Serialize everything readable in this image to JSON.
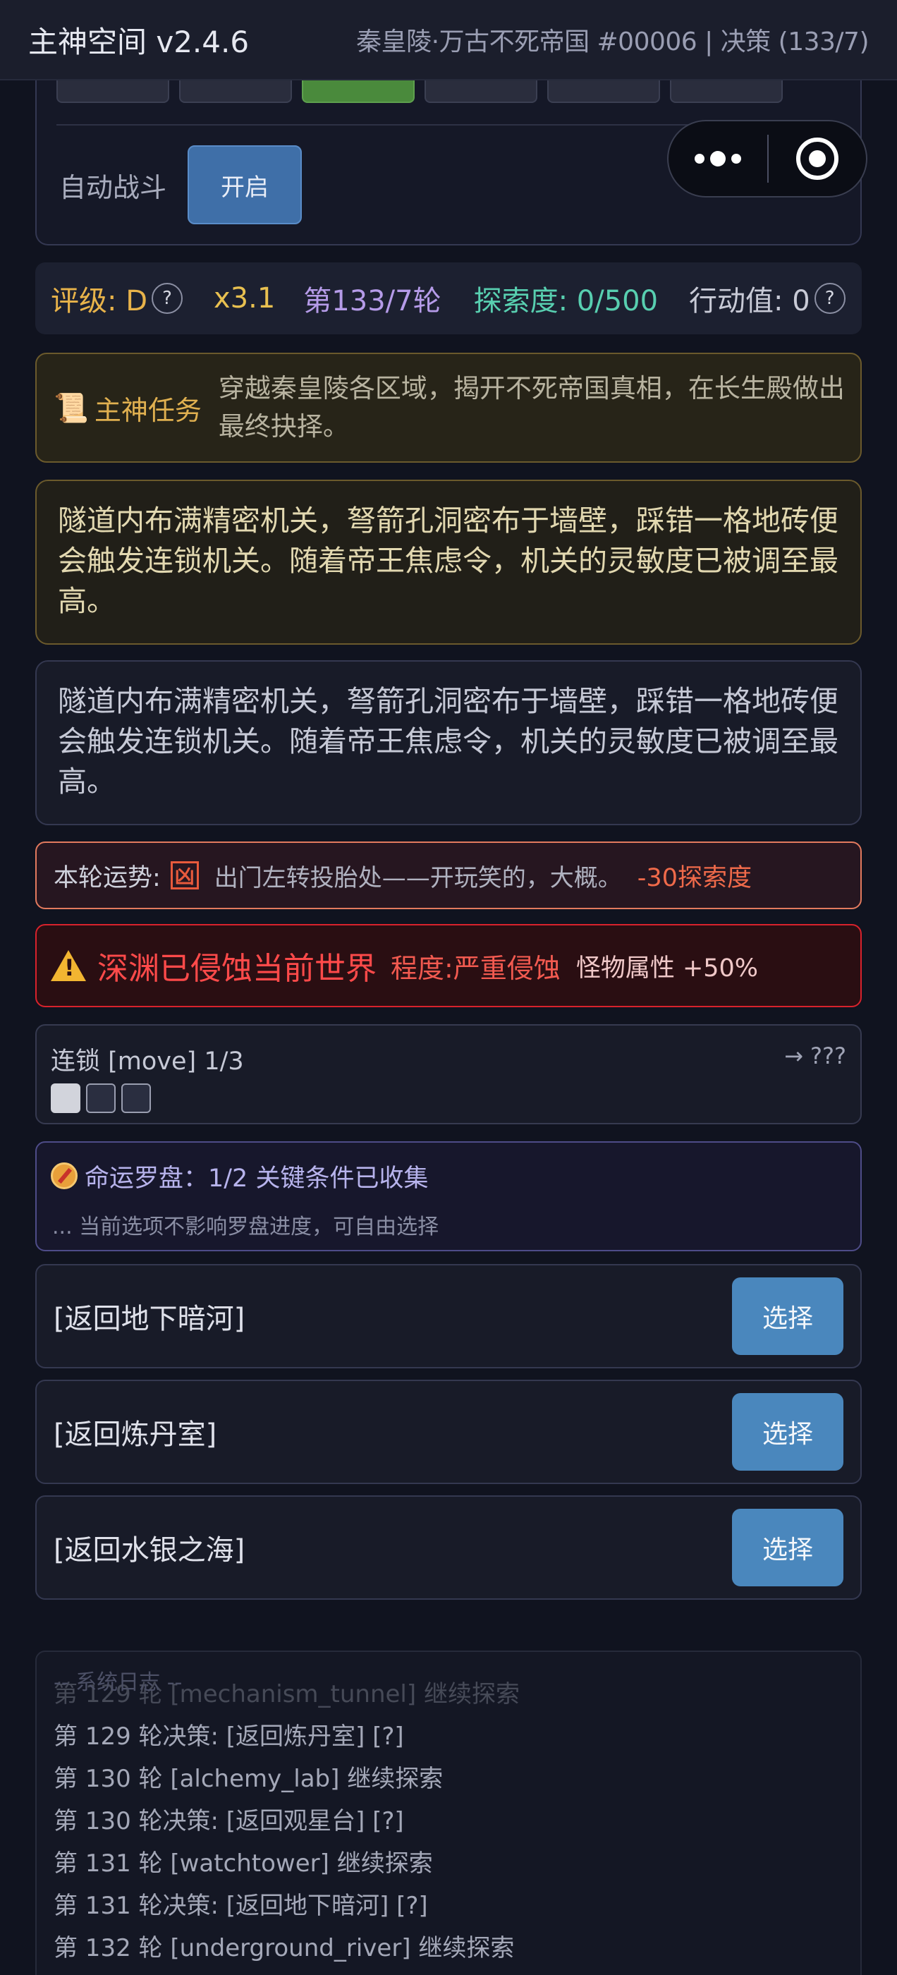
{
  "header": {
    "app_title": "主神空间 v2.4.6",
    "subtitle": "秦皇陵·万古不死帝国 #00006 | 决策 (133/7)"
  },
  "settings": {
    "auto_battle_label": "自动战斗",
    "auto_battle_button": "开启"
  },
  "status": {
    "rating": "评级: D",
    "multiplier": "x3.1",
    "round": "第133/7轮",
    "explore": "探索度: 0/500",
    "action": "行动值: 0",
    "help_symbol": "?"
  },
  "task": {
    "icon": "📜",
    "label": "主神任务",
    "text": "穿越秦皇陵各区域，揭开不死帝国真相，在长生殿做出最终抉择。"
  },
  "narrative": {
    "primary": "隧道内布满精密机关，弩箭孔洞密布于墙壁，踩错一格地砖便会触发连锁机关。随着帝王焦虑令，机关的灵敏度已被调至最高。",
    "secondary": "隧道内布满精密机关，弩箭孔洞密布于墙壁，踩错一格地砖便会触发连锁机关。随着帝王焦虑令，机关的灵敏度已被调至最高。"
  },
  "fortune": {
    "label": "本轮运势:",
    "sign": "凶",
    "text": "出门左转投胎处——开玩笑的，大概。",
    "effect": "-30探索度"
  },
  "abyss": {
    "title": "深渊已侵蚀当前世界",
    "level": "程度:严重侵蚀",
    "effect": "怪物属性 +50%"
  },
  "chain": {
    "label": "连锁 [move] 1/3",
    "next": "→ ???",
    "progress": {
      "filled": 1,
      "total": 3
    }
  },
  "compass": {
    "title": "命运罗盘：1/2 关键条件已收集",
    "note": "... 当前选项不影响罗盘进度，可自由选择"
  },
  "choices": [
    {
      "label": "[返回地下暗河]",
      "button": "选择"
    },
    {
      "label": "[返回炼丹室]",
      "button": "选择"
    },
    {
      "label": "[返回水银之海]",
      "button": "选择"
    }
  ],
  "log": {
    "title": "-- 系统日志 --",
    "lines": [
      "第 129 轮 [mechanism_tunnel] 继续探索",
      "第 129 轮决策: [返回炼丹室] [?]",
      "第 130 轮 [alchemy_lab] 继续探索",
      "第 130 轮决策: [返回观星台] [?]",
      "第 131 轮 [watchtower] 继续探索",
      "第 131 轮决策: [返回地下暗河] [?]",
      "第 132 轮 [underground_river] 继续探索"
    ]
  },
  "colors": {
    "accent_blue": "#4a87bd",
    "gold": "#e0b050",
    "danger": "#ff4a4a",
    "explore": "#58cfb0"
  }
}
